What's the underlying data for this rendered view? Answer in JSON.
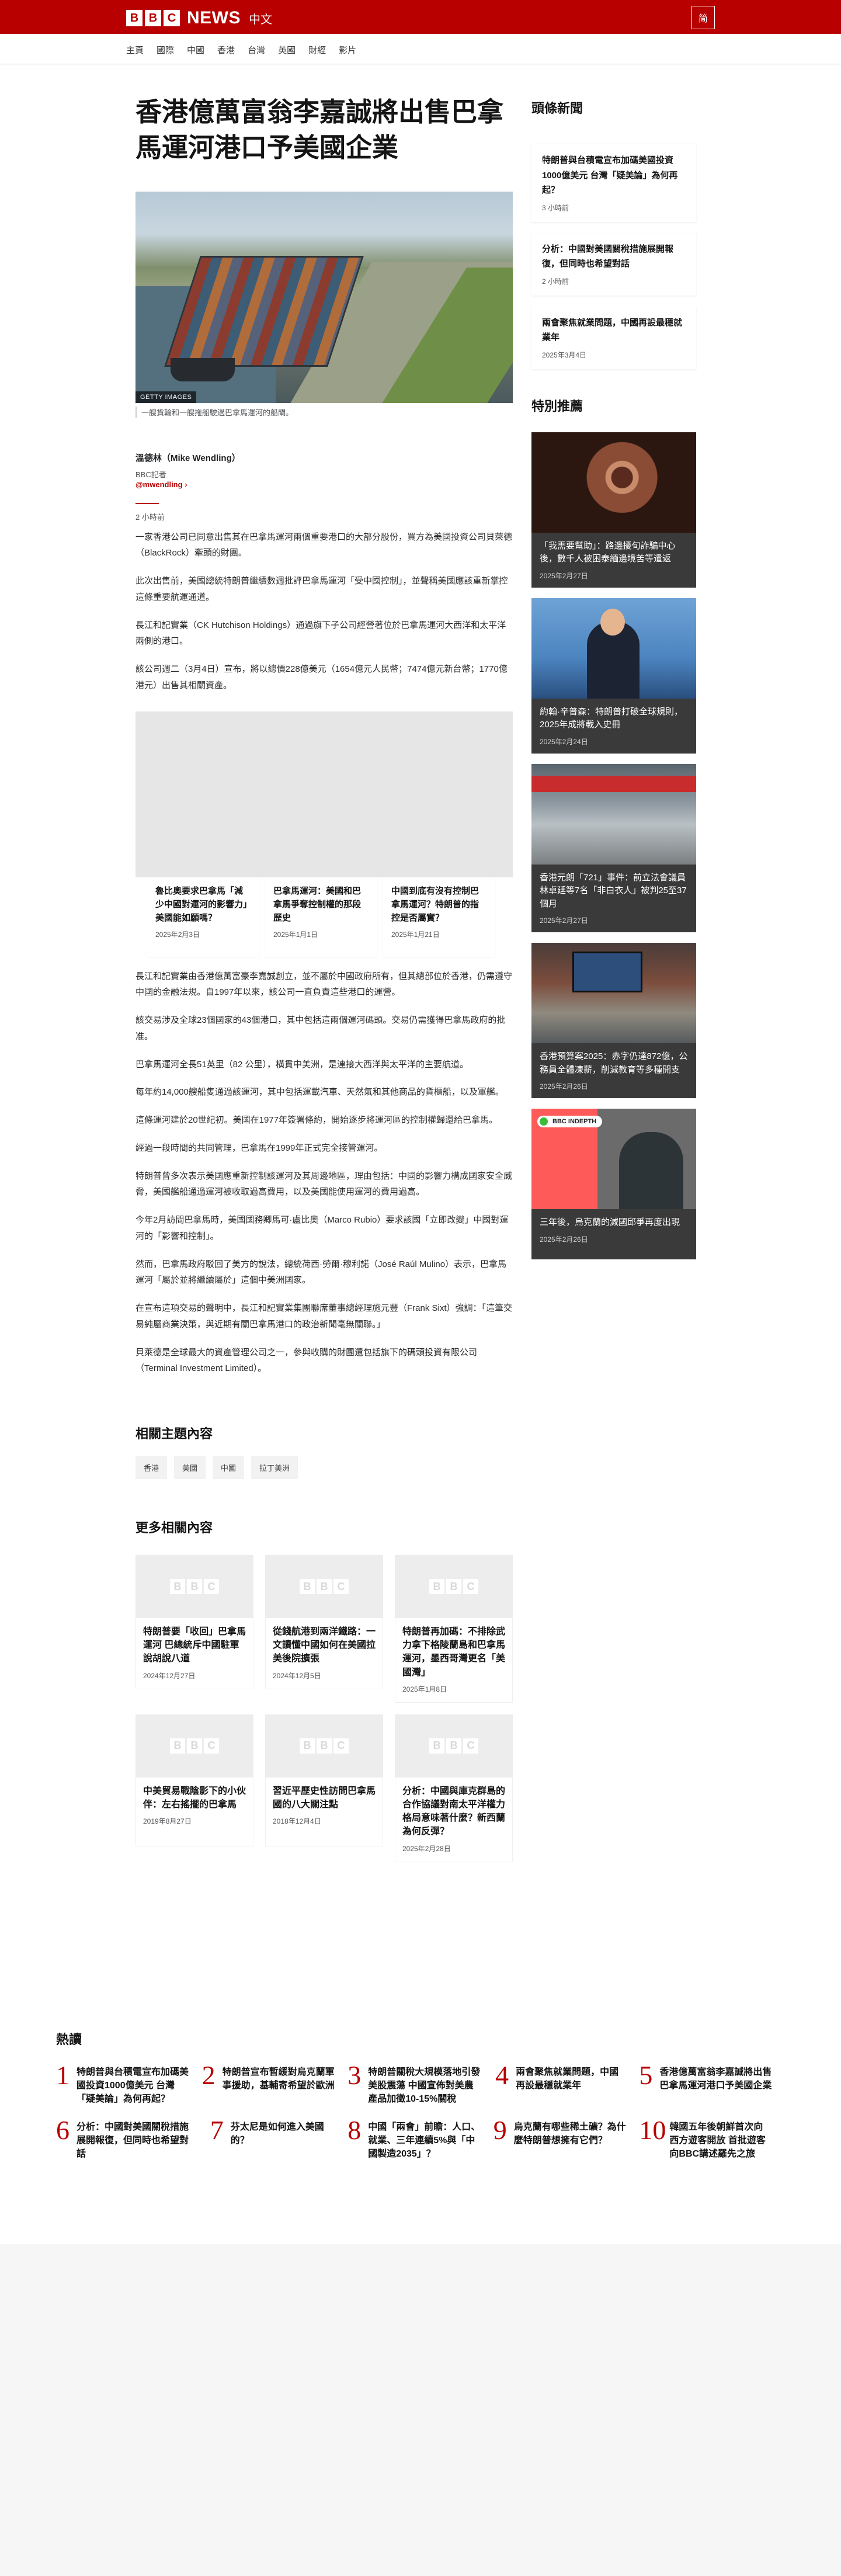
{
  "header": {
    "logo_letters": [
      "B",
      "B",
      "C"
    ],
    "logo_news": "NEWS",
    "logo_lang": "中文",
    "script_toggle": "简"
  },
  "nav": [
    "主頁",
    "國際",
    "中國",
    "香港",
    "台灣",
    "英國",
    "財經",
    "影片"
  ],
  "article": {
    "headline": "香港億萬富翁李嘉誠將出售巴拿馬運河港口予美國企業",
    "image_credit": "GETTY IMAGES",
    "image_caption": "一艘貨輪和一艘拖船駛過巴拿馬運河的船閘。",
    "author_name": "溫德林（Mike Wendling）",
    "author_role": "BBC記者",
    "author_handle": "@mwendling",
    "time": "2 小時前",
    "paragraphs_a": [
      "一家香港公司已同意出售其在巴拿馬運河兩個重要港口的大部分股份，買方為美國投資公司貝萊德（BlackRock）牽頭的財團。",
      "此次出售前，美國總統特朗普繼續數週批評巴拿馬運河「受中國控制」，並聲稱美國應該重新掌控這條重要航運通道。",
      "長江和記實業（CK Hutchison Holdings）通過旗下子公司經營著位於巴拿馬運河大西洋和太平洋兩側的港口。",
      "該公司週二（3月4日）宣布，將以總價228億美元（1654億元人民幣；7474億元新台幣；1770億港元）出售其相關資產。"
    ],
    "promos": [
      {
        "title": "魯比奧要求巴拿馬「減少中國對運河的影響力」美國能如願嗎？",
        "date": "2025年2月3日"
      },
      {
        "title": "巴拿馬運河：美國和巴拿馬爭奪控制權的那段歷史",
        "date": "2025年1月1日"
      },
      {
        "title": "中國到底有沒有控制巴拿馬運河？特朗普的指控是否屬實？",
        "date": "2025年1月21日"
      }
    ],
    "paragraphs_b": [
      "長江和記實業由香港億萬富豪李嘉誠創立，並不屬於中國政府所有，但其總部位於香港，仍需遵守中國的金融法規。自1997年以來，該公司一直負責這些港口的運營。",
      "該交易涉及全球23個國家的43個港口，其中包括這兩個運河碼頭。交易仍需獲得巴拿馬政府的批准。",
      "巴拿馬運河全長51英里（82 公里），橫貫中美洲，是連接大西洋與太平洋的主要航道。",
      "每年約14,000艘船隻通過該運河，其中包括運載汽車、天然氣和其他商品的貨櫃船，以及軍艦。",
      "這條運河建於20世紀初。美國在1977年簽署條約，開始逐步將運河區的控制權歸還給巴拿馬。",
      "經過一段時間的共同管理，巴拿馬在1999年正式完全接管運河。",
      "特朗普曾多次表示美國應重新控制該運河及其周邊地區，理由包括：中國的影響力構成國家安全威脅，美國艦船通過運河被收取過高費用，以及美國能使用運河的費用過高。",
      "今年2月訪問巴拿馬時，美國國務卿馬可·盧比奧（Marco Rubio）要求該國「立即改變」中國對運河的「影響和控制」。",
      "然而，巴拿馬政府駁回了美方的說法，總統荷西·勞爾·穆利諾（José Raúl Mulino）表示，巴拿馬運河「屬於並將繼續屬於」這個中美洲國家。",
      "在宣布這項交易的聲明中，長江和記實業集團聯席董事總經理施元豐（Frank Sixt）強調：「這筆交易純屬商業決策，與近期有關巴拿馬港口的政治新聞毫無關聯。」",
      "貝萊德是全球最大的資產管理公司之一，參與收購的財團還包括旗下的碼頭投資有限公司（Terminal Investment Limited）。"
    ]
  },
  "topics": {
    "title": "相關主題內容",
    "tags": [
      "香港",
      "美國",
      "中國",
      "拉丁美洲"
    ]
  },
  "more": {
    "title": "更多相關內容",
    "placeholder_letters": [
      "B",
      "B",
      "C"
    ],
    "items": [
      {
        "title": "特朗普要「收回」巴拿馬運河 巴總統斥中國駐軍說胡說八道",
        "date": "2024年12月27日"
      },
      {
        "title": "從錢航港到兩洋鐵路：一文讀懂中國如何在美國拉美後院擴張",
        "date": "2024年12月5日"
      },
      {
        "title": "特朗普再加碼：不排除武力拿下格陵蘭島和巴拿馬運河，墨西哥灣更名「美國灣」",
        "date": "2025年1月8日"
      },
      {
        "title": "中美貿易戰陰影下的小伙伴：左右搖擺的巴拿馬",
        "date": "2019年8月27日"
      },
      {
        "title": "習近平歷史性訪問巴拿馬國的八大關注點",
        "date": "2018年12月4日"
      },
      {
        "title": "分析：中國與庫克群島的合作協議對南太平洋權力格局意味著什麼？新西蘭為何反彈？",
        "date": "2025年2月28日"
      }
    ]
  },
  "sidebar": {
    "headlines_title": "頭條新聞",
    "headlines": [
      {
        "title": "特朗普與台積電宣布加碼美國投資1000億美元 台灣「疑美論」為何再起？",
        "date": "3 小時前"
      },
      {
        "title": "分析：中國對美國關稅措施展開報復，但同時也希望對話",
        "date": "2 小時前"
      },
      {
        "title": "兩會聚焦就業問題，中國再設最穩就業年",
        "date": "2025年3月4日"
      }
    ],
    "featured_title": "特別推薦",
    "featured": [
      {
        "title": "「我需要幫助」：路邊擾旬詐騙中心後，數千人被困泰緬邊境苦等遣返",
        "date": "2025年2月27日"
      },
      {
        "title": "約翰·辛普森：特朗普打破全球規則，2025年成將載入史冊",
        "date": "2025年2月24日"
      },
      {
        "title": "香港元朗「721」事件：前立法會議員林卓廷等7名「非白衣人」被判25至37個月",
        "date": "2025年2月27日"
      },
      {
        "title": "香港預算案2025：赤字仍達872億，公務員全體凍薪，削減教育等多種開支",
        "date": "2025年2月26日"
      },
      {
        "title": "三年後，烏克蘭的減國邱爭再度出現",
        "date": "2025年2月26日",
        "badge": "INDEPTH"
      }
    ]
  },
  "most_read": {
    "title": "熱讀",
    "items": [
      {
        "num": "1",
        "title": "特朗普與台積電宣布加碼美國投資1000億美元 台灣「疑美論」為何再起？"
      },
      {
        "num": "2",
        "title": "特朗普宣布暫緩對烏克蘭軍事援助，基輔寄希望於歐洲"
      },
      {
        "num": "3",
        "title": "特朗普關稅大規模落地引發美股震蕩 中國宣佈對美農產品加徵10-15%關稅"
      },
      {
        "num": "4",
        "title": "兩會聚焦就業問題，中國再設最穩就業年"
      },
      {
        "num": "5",
        "title": "香港億萬富翁李嘉誠將出售巴拿馬運河港口予美國企業"
      },
      {
        "num": "6",
        "title": "分析：中國對美國關稅措施展開報復，但同時也希望對話"
      },
      {
        "num": "7",
        "title": "芬太尼是如何進入美國的？"
      },
      {
        "num": "8",
        "title": "中國「兩會」前瞻：人口、就業、三年連續5%與「中國製造2035」？"
      },
      {
        "num": "9",
        "title": "烏克蘭有哪些稀土礦？為什麼特朗普想擁有它們？"
      },
      {
        "num": "10",
        "title": "韓國五年後朝鮮首次向西方遊客開放 首批遊客向BBC講述羅先之旅"
      }
    ]
  },
  "colors": {
    "brand_red": "#b80000",
    "text": "#202224",
    "muted": "#545658"
  }
}
